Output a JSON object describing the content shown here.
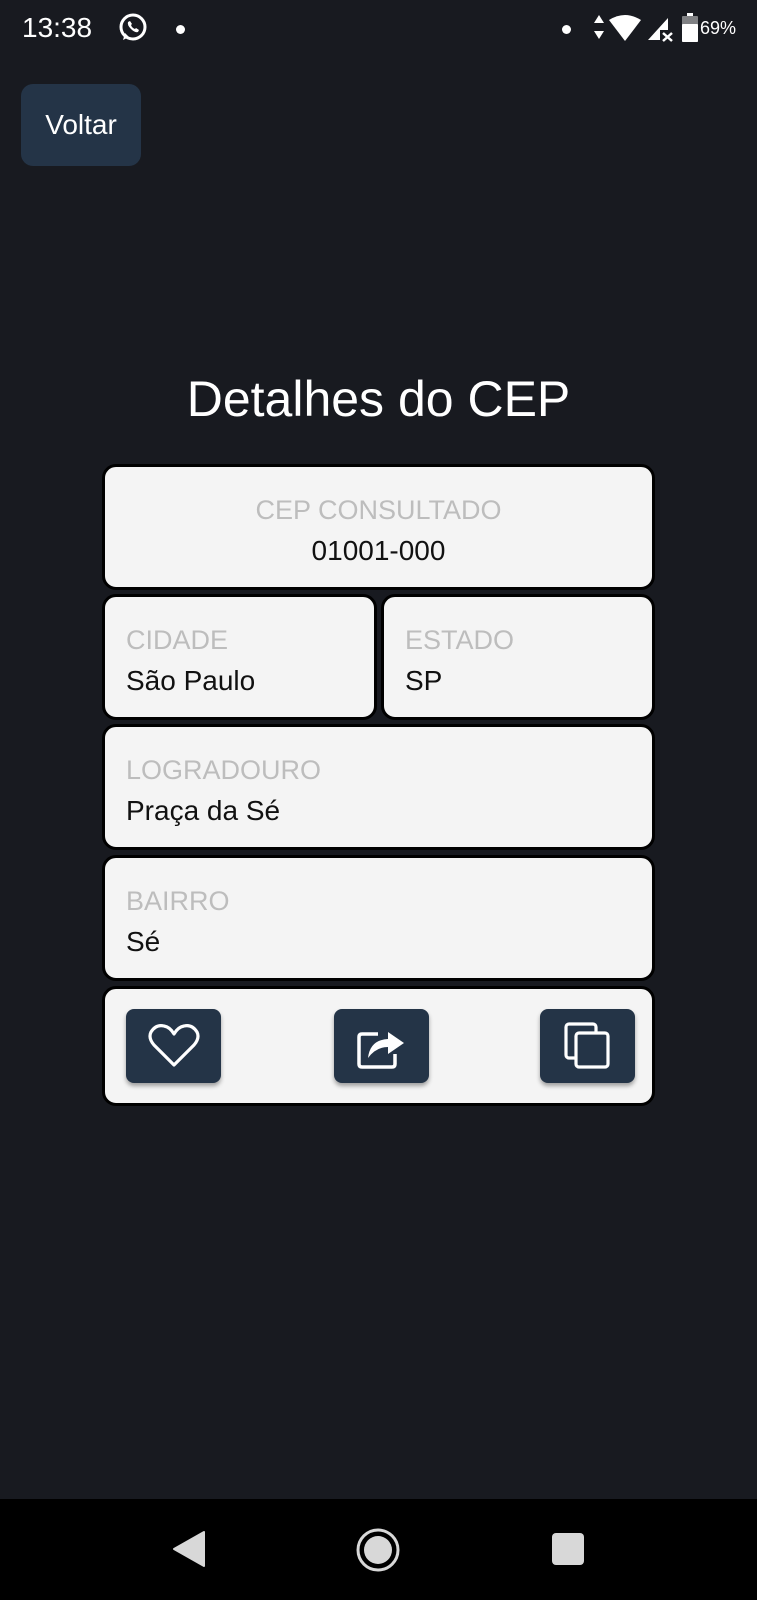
{
  "status_bar": {
    "time": "13:38",
    "battery": "69%",
    "icons": [
      "whatsapp-icon",
      "notification-dot-icon",
      "data-arrows-icon",
      "wifi-icon",
      "signal-icon",
      "battery-icon"
    ]
  },
  "header": {
    "back_label": "Voltar"
  },
  "page": {
    "title": "Detalhes do CEP"
  },
  "details": {
    "cep": {
      "label": "CEP CONSULTADO",
      "value": "01001-000"
    },
    "cidade": {
      "label": "CIDADE",
      "value": "São Paulo"
    },
    "estado": {
      "label": "ESTADO",
      "value": "SP"
    },
    "logradouro": {
      "label": "LOGRADOURO",
      "value": "Praça da Sé"
    },
    "bairro": {
      "label": "BAIRRO",
      "value": "Sé"
    }
  },
  "actions": {
    "icons": [
      "heart-icon",
      "share-icon",
      "copy-icon"
    ]
  },
  "colors": {
    "background": "#181a20",
    "button_bg": "#243447",
    "card_bg": "#f4f4f4",
    "label_gray": "#bdbdbd"
  }
}
